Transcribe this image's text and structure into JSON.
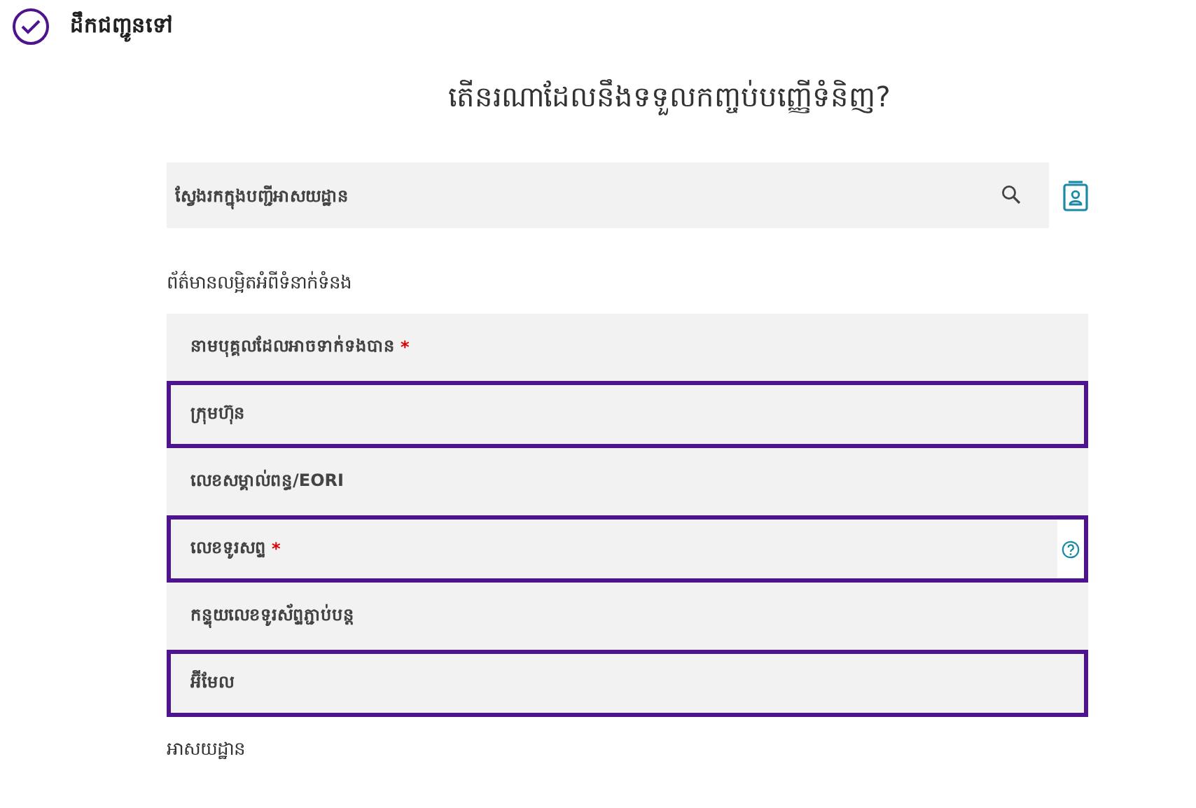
{
  "header": {
    "title": "ដឹកជញ្ជូនទៅ",
    "completed": true
  },
  "heading": "តើនរណាដែលនឹងទទួលកញ្ចប់បញ្ញើទំនិញ?",
  "search": {
    "placeholder": "ស្វែងរកក្នុងបញ្ជីអាសយដ្ឋាន"
  },
  "contact_section": "ព័ត៌មានលម្អិតអំពីទំនាក់ទំនង",
  "fields": [
    {
      "placeholder": "នាមបុគ្គលដែលអាចទាក់ទងបាន",
      "required_mark": "*",
      "outlined": false,
      "help": false
    },
    {
      "placeholder": "ក្រុមហ៊ុន",
      "outlined": true,
      "help": false
    },
    {
      "placeholder": "លេខសម្គាល់ពន្ធ/EORI",
      "outlined": false,
      "help": false
    },
    {
      "placeholder": "លេខទូរសព្ទ",
      "required_mark": "*",
      "outlined": true,
      "help": true
    },
    {
      "placeholder": "កន្ទុយលេខទូរស័ព្ទភ្ជាប់បន្ត",
      "outlined": false,
      "help": false
    },
    {
      "placeholder": "អ៊ីមែល",
      "outlined": true,
      "help": false
    }
  ],
  "address_section": "អាសយដ្ឋាន"
}
